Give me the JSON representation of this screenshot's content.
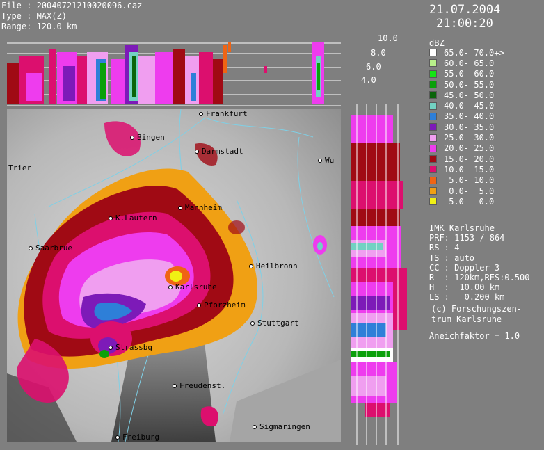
{
  "header": {
    "file": "File : 20040721210020096.caz",
    "type": "Type : MAX(Z)",
    "range": "Range: 120.0 km"
  },
  "datetime": {
    "date": "21.07.2004",
    "time": "21:00:20"
  },
  "legend": {
    "unit": "dBZ",
    "items": [
      {
        "label": "65.0- 70.0+>",
        "color": "#ffffff"
      },
      {
        "label": "60.0- 65.0",
        "color": "#b8f08a"
      },
      {
        "label": "55.0- 60.0",
        "color": "#14e614"
      },
      {
        "label": "50.0- 55.0",
        "color": "#0aa00a"
      },
      {
        "label": "45.0- 50.0",
        "color": "#0a640a"
      },
      {
        "label": "40.0- 45.0",
        "color": "#72d2c2"
      },
      {
        "label": "35.0- 40.0",
        "color": "#2e7fd8"
      },
      {
        "label": "30.0- 35.0",
        "color": "#7d1ab8"
      },
      {
        "label": "25.0- 30.0",
        "color": "#f09ef0"
      },
      {
        "label": "20.0- 25.0",
        "color": "#ee3cee"
      },
      {
        "label": "15.0- 20.0",
        "color": "#a00a14"
      },
      {
        "label": "10.0- 15.0",
        "color": "#dc0f6e"
      },
      {
        "label": " 5.0- 10.0",
        "color": "#f06414"
      },
      {
        "label": " 0.0-  5.0",
        "color": "#f0a014"
      },
      {
        "label": "-5.0-  0.0",
        "color": "#f0f014"
      }
    ]
  },
  "info": [
    "IMK Karlsruhe",
    "PRF: 1153 / 864",
    "RS : 4",
    "TS : auto",
    "CC : Doppler 3",
    "R  : 120km,RES:0.500",
    "H  :  10.00 km",
    "LS :   0.200 km"
  ],
  "copyright": [
    "(c) Forschungszen-",
    "trum Karlsruhe"
  ],
  "factor": "Aneichfaktor = 1.0",
  "height_labels": [
    "10.0",
    "8.0",
    "6.0",
    "4.0"
  ],
  "cities": [
    {
      "name": "Frankfurt",
      "dot": true
    },
    {
      "name": "Bingen",
      "dot": true
    },
    {
      "name": "Darmstadt",
      "dot": true
    },
    {
      "name": "Trier",
      "dot": false
    },
    {
      "name": "Wu",
      "dot": true
    },
    {
      "name": "Mannheim",
      "dot": true
    },
    {
      "name": "K.Lautern",
      "dot": true
    },
    {
      "name": "Saarbrue",
      "dot": true
    },
    {
      "name": "Heilbronn",
      "dot": true
    },
    {
      "name": "Karlsruhe",
      "dot": true
    },
    {
      "name": "Pforzheim",
      "dot": true
    },
    {
      "name": "Stuttgart",
      "dot": true
    },
    {
      "name": "Strassbg",
      "dot": true
    },
    {
      "name": "Freudenst.",
      "dot": true
    },
    {
      "name": "Sigmaringen",
      "dot": true
    },
    {
      "name": "Freiburg",
      "dot": true
    }
  ],
  "colors": {
    "background": "#7f7f7f",
    "text": "#ffffff",
    "rivers": "#7fd0e6",
    "city_text": "#000000"
  }
}
